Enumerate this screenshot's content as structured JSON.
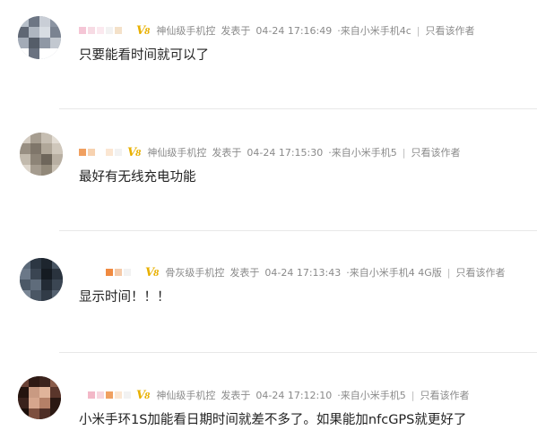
{
  "comments": [
    {
      "level": "神仙级手机控",
      "posted_label": "发表于",
      "time": "04-24 17:16:49",
      "device": "·来自小米手机4c",
      "author_only": "只看该作者",
      "text": "只要能看时间就可以了"
    },
    {
      "level": "神仙级手机控",
      "posted_label": "发表于",
      "time": "04-24 17:15:30",
      "device": "·来自小米手机5",
      "author_only": "只看该作者",
      "text": "最好有无线充电功能"
    },
    {
      "level": "骨灰级手机控",
      "posted_label": "发表于",
      "time": "04-24 17:13:43",
      "device": "·来自小米手机4 4G版",
      "author_only": "只看该作者",
      "text": "显示时间！！！"
    },
    {
      "level": "神仙级手机控",
      "posted_label": "发表于",
      "time": "04-24 17:12:10",
      "device": "·来自小米手机5",
      "author_only": "只看该作者",
      "text": "小米手环1S加能看日期时间就差不多了。如果能加nfcGPS就更好了"
    }
  ],
  "badge": {
    "main": "V",
    "sub": "8"
  },
  "colors": {
    "meta_text": "#8a8a8a",
    "badge": "#e8b000",
    "divider": "#e8e8e8"
  }
}
